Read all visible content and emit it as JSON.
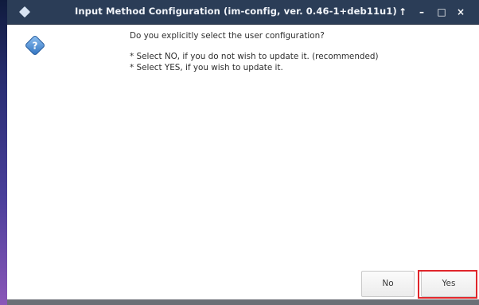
{
  "window": {
    "title": "Input Method Configuration (im-config, ver. 0.46-1+deb11u1)",
    "controls": {
      "up": "↑",
      "minimize": "–",
      "maximize": "□",
      "close": "×"
    }
  },
  "dialog": {
    "icon": "question-icon",
    "question": "Do you explicitly select the user configuration?",
    "options": [
      "* Select NO, if you do not wish to update it. (recommended)",
      "* Select YES, if you wish to update it."
    ]
  },
  "buttons": {
    "no_label": "No",
    "yes_label": "Yes"
  },
  "colors": {
    "titlebar": "#2b3d57",
    "highlight_border": "#e0262b",
    "question_icon": "#4a8fd6"
  }
}
